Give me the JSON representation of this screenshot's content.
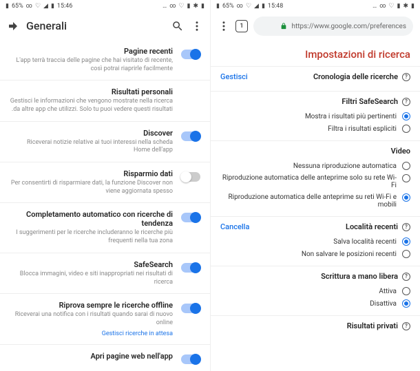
{
  "left": {
    "status": {
      "time": "15:48",
      "battery": "65%"
    },
    "url": "https://www.google.com/preferences",
    "tab_count": "1",
    "page_title": "Impostazioni di ricerca",
    "history": {
      "heading": "Cronologia delle ricerche",
      "manage": "Gestisci"
    },
    "safesearch": {
      "heading": "Filtri SafeSearch",
      "opt1": "Mostra i risultati più pertinenti",
      "opt2": "Filtra i risultati espliciti"
    },
    "video": {
      "heading": "Video",
      "opt1": "Nessuna riproduzione automatica",
      "opt2": "Riproduzione automatica delle anteprime solo su rete Wi-Fi",
      "opt3": "Riproduzione automatica delle anteprime su reti Wi-Fi e mobili"
    },
    "location": {
      "heading": "Località recenti",
      "delete": "Cancella",
      "opt1": "Salva località recenti",
      "opt2": "Non salvare le posizioni recenti"
    },
    "handwriting": {
      "heading": "Scrittura a mano libera",
      "opt1": "Attiva",
      "opt2": "Disattiva"
    },
    "private": {
      "heading": "Risultati privati"
    }
  },
  "right": {
    "status": {
      "time": "15:46",
      "battery": "65%"
    },
    "title": "Generali",
    "items": [
      {
        "title": "Pagine recenti",
        "desc": "L'app terrà traccia delle pagine che hai visitato di recente, così potrai riaprirle facilmente",
        "on": true
      },
      {
        "title": "Risultati personali",
        "desc": "Gestisci le informazioni che vengono mostrate nella ricerca da altre app che utilizzi. Solo tu puoi vedere questi risultati.",
        "on": null
      },
      {
        "title": "Discover",
        "desc": "Riceverai notizie relative ai tuoi interessi nella scheda Home dell'app",
        "on": true
      },
      {
        "title": "Risparmio dati",
        "desc": "Per consentirti di risparmiare dati, la funzione Discover non viene aggiornata spesso",
        "on": false
      },
      {
        "title": "Completamento automatico con ricerche di tendenza",
        "desc": "I suggerimenti per le ricerche includeranno le ricerche più frequenti nella tua zona",
        "on": true
      },
      {
        "title": "SafeSearch",
        "desc": "Blocca immagini, video e siti inappropriati nei risultati di ricerca",
        "on": true
      },
      {
        "title": "Riprova sempre le ricerche offline",
        "desc": "Riceverai una notifica con i risultati quando sarai di nuovo online",
        "on": true,
        "link": "Gestisci ricerche in attesa"
      },
      {
        "title": "Apri pagine web nell'app",
        "desc": "",
        "on": true
      }
    ]
  }
}
